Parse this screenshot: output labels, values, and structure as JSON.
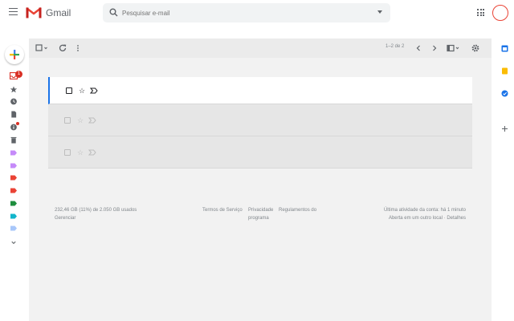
{
  "app": {
    "brand": "Gmail"
  },
  "search": {
    "placeholder": "Pesquisar e-mail"
  },
  "toolbar": {
    "count": "1–2 de 2"
  },
  "sidebar": {
    "badge": "1"
  },
  "colors": {
    "accent": "#1a73e8",
    "red": "#d93025",
    "rail_blue": "#1a73e8",
    "rail_yellow": "#fbbc04"
  },
  "labels": [
    {
      "color": "#c58af9"
    },
    {
      "color": "#c58af9"
    },
    {
      "color": "#ea4335"
    },
    {
      "color": "#ea4335"
    },
    {
      "color": "#1e8e3e"
    },
    {
      "color": "#12b5cb"
    },
    {
      "color": "#a8c7fa"
    }
  ],
  "footer": {
    "storage": "232,46 GB (11%) de 2.050 GB usados",
    "manage": "Gerenciar",
    "terms": "Termos de Serviço",
    "privacy": "Privacidade",
    "program": "Regulamentos do",
    "program2": "programa",
    "activity": "Última atividade da conta: há 1 minuto",
    "open_in": "Aberta em um outro local",
    "details": "Detalhes"
  }
}
